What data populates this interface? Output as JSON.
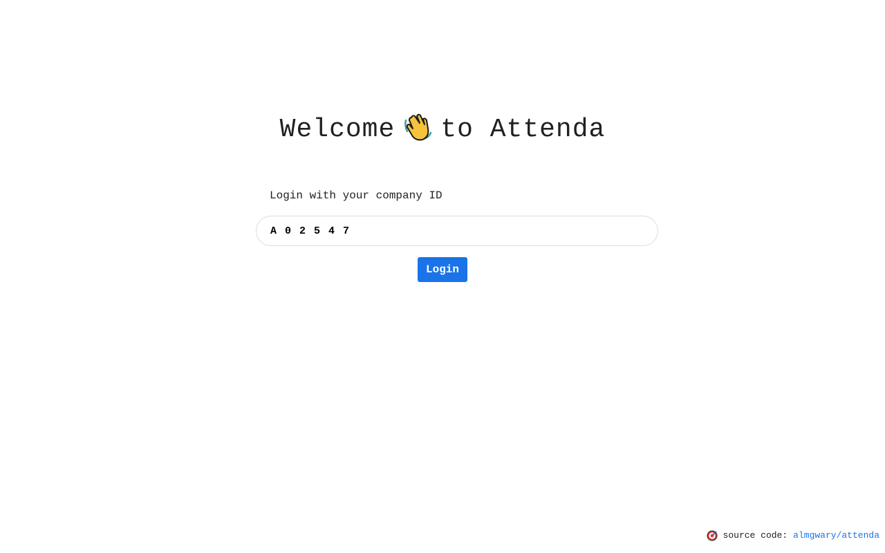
{
  "header": {
    "title_before": "Welcome",
    "title_icon": "waving-hand-icon",
    "title_after": "to Attenda"
  },
  "login": {
    "label": "Login with your company ID",
    "input_value": "A02547",
    "button_label": "Login"
  },
  "footer": {
    "icon": "target-icon",
    "text": "source code:",
    "link_text": "almgwary/attenda"
  },
  "colors": {
    "accent": "#1a73e8",
    "text": "#202124",
    "input_border": "#dcdcdc"
  }
}
